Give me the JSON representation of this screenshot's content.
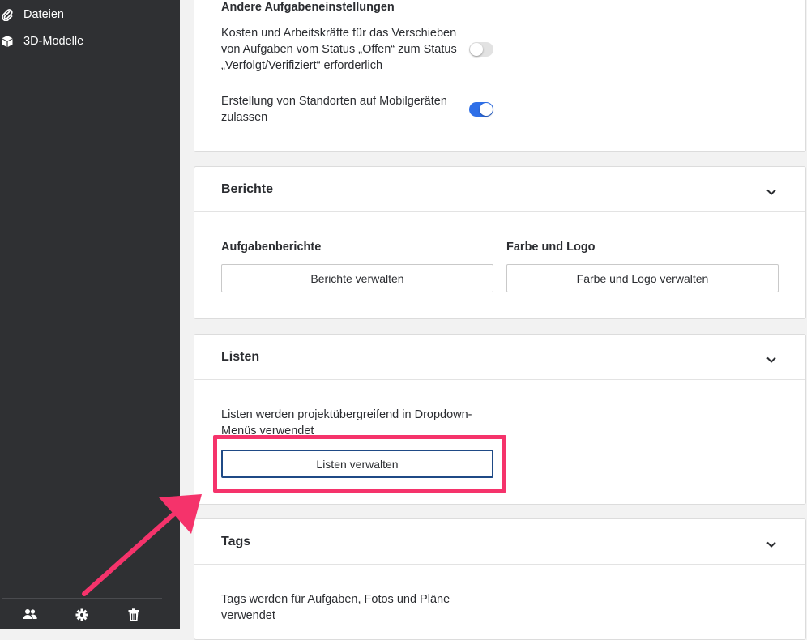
{
  "sidebar": {
    "items": [
      {
        "label": "Dateien",
        "icon": "paperclip-icon"
      },
      {
        "label": "3D-Modelle",
        "icon": "cube-icon"
      }
    ],
    "bottom_icons": [
      "users-icon",
      "gear-icon",
      "trash-icon"
    ]
  },
  "task_settings": {
    "heading": "Andere Aufgabeneinstellungen",
    "settings": [
      {
        "label": "Kosten und Arbeitskräfte für das Verschieben von Aufgaben vom Status „Offen“ zum Status „Verfolgt/Verifiziert“ erforderlich",
        "enabled": false
      },
      {
        "label": "Erstellung von Standorten auf Mobilgeräten zulassen",
        "enabled": true
      }
    ]
  },
  "reports": {
    "title": "Berichte",
    "task_reports_heading": "Aufgabenberichte",
    "manage_reports_label": "Berichte verwalten",
    "color_logo_heading": "Farbe und Logo",
    "manage_color_logo_label": "Farbe und Logo verwalten"
  },
  "lists": {
    "title": "Listen",
    "description": "Listen werden projektübergreifend in Dropdown-Menüs verwendet",
    "manage_lists_label": "Listen verwalten"
  },
  "tags": {
    "title": "Tags",
    "description": "Tags werden für Aufgaben, Fotos und Pläne verwendet"
  },
  "colors": {
    "sidebar_bg": "#2f3033",
    "toggle_on": "#2e6fe8",
    "annotation": "#f5336b"
  }
}
